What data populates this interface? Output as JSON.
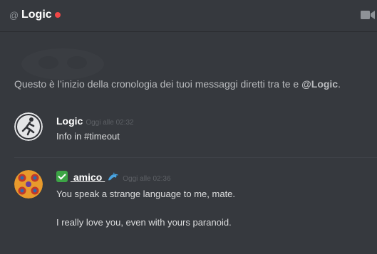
{
  "header": {
    "at_symbol": "@",
    "name": "Logic",
    "status_color": "#f04747",
    "video_icon": "video-call-icon"
  },
  "intro": {
    "text": "Questo è l’inizio della cronologia dei tuoi messaggi diretti tra te e ",
    "name": "@Logic",
    "end": "."
  },
  "messages": [
    {
      "author": "Logic",
      "timestamp": "Oggi alle 02:32",
      "lines": [
        "Info in #timeout"
      ],
      "avatar": "running-man-avatar"
    },
    {
      "author_badge": "check-mark-emoji",
      "author": " amico ",
      "author_suffix": "dolphin-emoji",
      "timestamp": "Oggi alle 02:36",
      "lines": [
        "You speak a strange language to me, mate.",
        "I really love you, even with yours paranoid."
      ],
      "avatar": "orange-pattern-avatar"
    }
  ],
  "colors": {
    "background": "#36393e",
    "text": "#dcddde",
    "muted": "#8e9297",
    "timestamp": "#5e6166"
  }
}
